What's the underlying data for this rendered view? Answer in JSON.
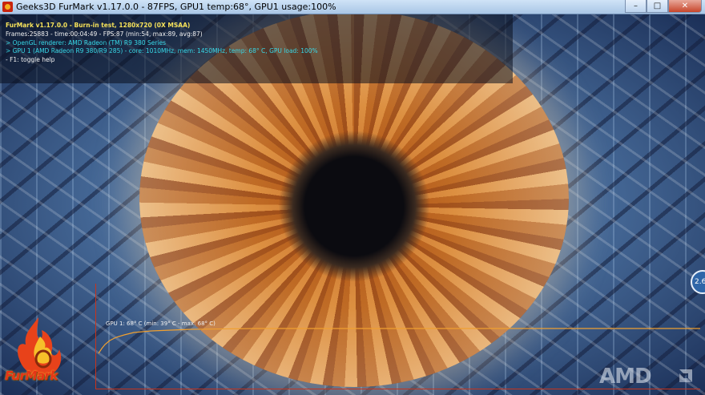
{
  "window": {
    "title": "Geeks3D FurMark v1.17.0.0 - 87FPS, GPU1 temp:68°, GPU1 usage:100%",
    "minimize_glyph": "–",
    "maximize_glyph": "□",
    "close_glyph": "✕"
  },
  "overlay": {
    "line1": "FurMark v1.17.0.0 - Burn-in test, 1280x720 (0X MSAA)",
    "line2": "Frames:25883 - time:00:04:49 - FPS:87 (min:54, max:89, avg:87)",
    "line3": "> OpenGL renderer: AMD Radeon (TM) R9 380 Series",
    "line4": "> GPU 1 (AMD Radeon R9 380/R9 285) - core: 1010MHz, mem: 1450MHz, temp: 68° C, GPU load: 100%",
    "line5": "- F1: toggle help"
  },
  "graph": {
    "label": "GPU 1: 68° C (min: 39° C - max: 68° C)"
  },
  "logos": {
    "furmark": "FurMark",
    "amd": "AMD"
  },
  "side_badge": "2.6",
  "colors": {
    "overlay_title": "#f6e25a",
    "overlay_text": "#f2f2f2",
    "overlay_gpu": "#37d9e8",
    "graph_axis": "#c9331b",
    "graph_line": "#f0a030"
  },
  "icons": {
    "app_icon": "furmark-app-icon",
    "amd_arrow": "amd-arrow-icon"
  }
}
